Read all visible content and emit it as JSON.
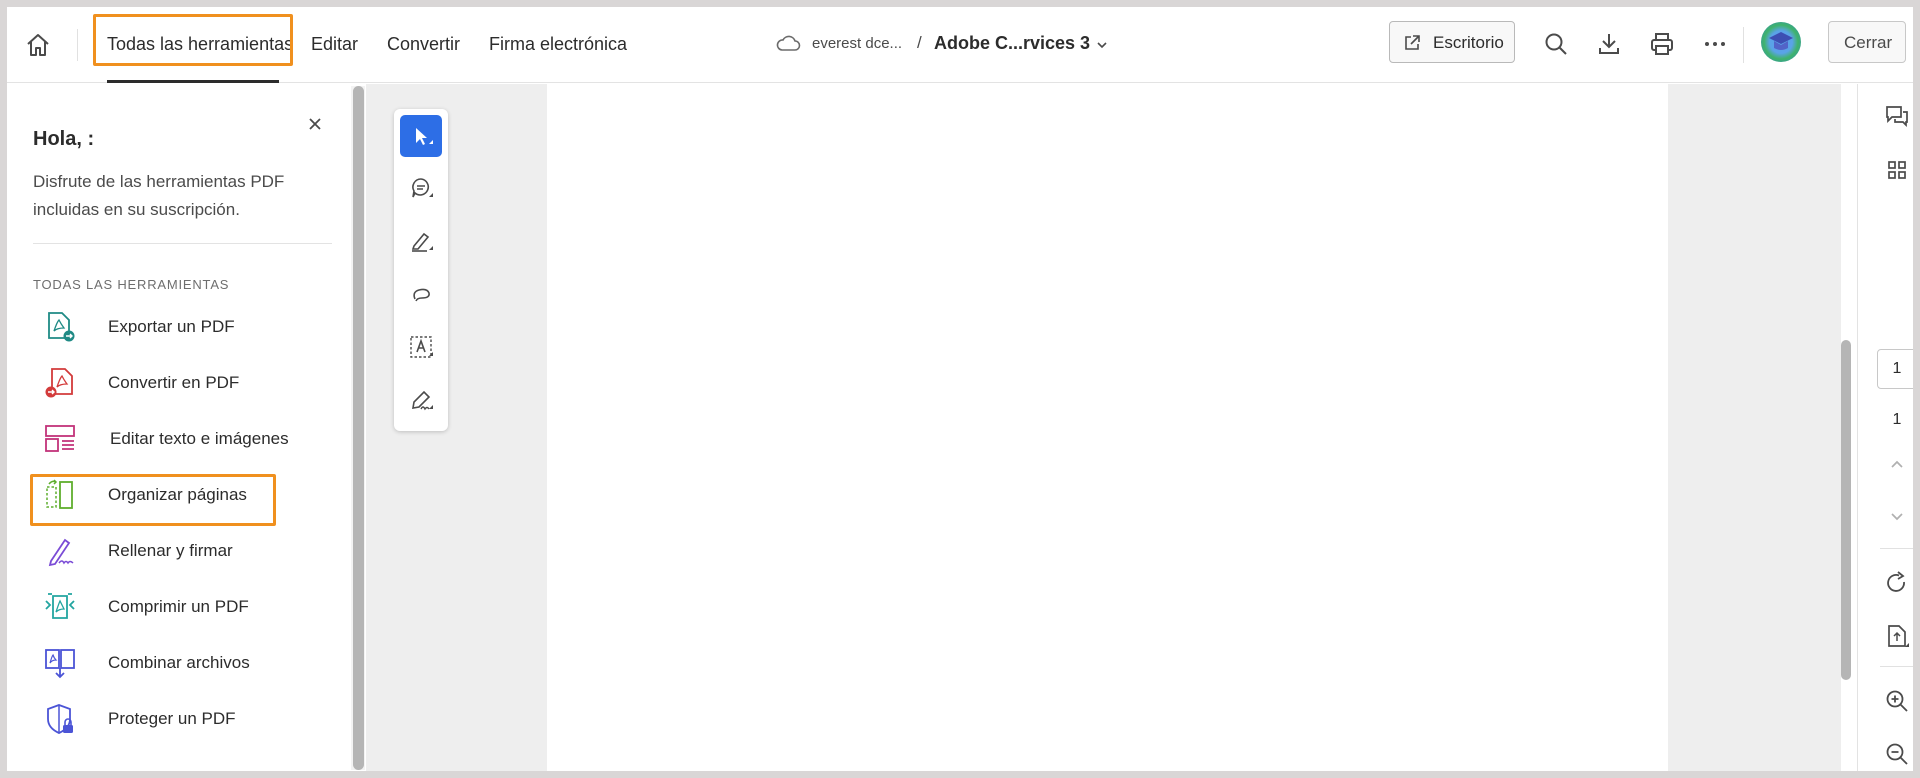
{
  "nav": {
    "home_label": "home",
    "items": [
      "Todas las herramientas",
      "Editar",
      "Convertir",
      "Firma electrónica"
    ]
  },
  "breadcrumb": {
    "folder": "everest dce...",
    "separator": "/",
    "file": "Adobe C...rvices 3"
  },
  "toolbar": {
    "desktop_label": "Escritorio",
    "close_label": "Cerrar"
  },
  "panel": {
    "greeting": "Hola, :",
    "description": "Disfrute de las herramientas PDF incluidas en su suscripción.",
    "section_title": "TODAS LAS HERRAMIENTAS",
    "tools": [
      {
        "label": "Exportar un PDF",
        "icon": "export-pdf-icon"
      },
      {
        "label": "Convertir en PDF",
        "icon": "create-pdf-icon"
      },
      {
        "label": "Editar texto e imágenes",
        "icon": "edit-text-images-icon"
      },
      {
        "label": "Organizar páginas",
        "icon": "organize-pages-icon"
      },
      {
        "label": "Rellenar y firmar",
        "icon": "fill-sign-icon"
      },
      {
        "label": "Comprimir un PDF",
        "icon": "compress-pdf-icon"
      },
      {
        "label": "Combinar archivos",
        "icon": "combine-files-icon"
      },
      {
        "label": "Proteger un PDF",
        "icon": "protect-pdf-icon"
      }
    ]
  },
  "pager": {
    "current": "1",
    "total": "1"
  },
  "colors": {
    "highlight": "#f0901e",
    "accent": "#2d6ee6"
  }
}
